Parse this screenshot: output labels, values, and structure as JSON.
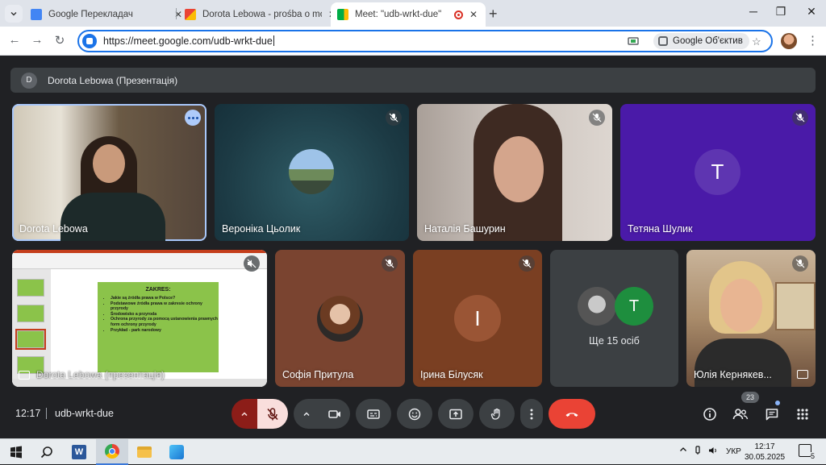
{
  "browser": {
    "tabs": [
      {
        "title": "Google Перекладач",
        "favicon_color": "#4285f4"
      },
      {
        "title": "Dorota Lebowa - prośba o możliwość",
        "favicon_color": "#ea4335"
      },
      {
        "title": "Meet: \"udb-wrkt-due\"",
        "favicon_color": "#00ac47",
        "active": true,
        "recording": true
      }
    ],
    "url": "https://meet.google.com/udb-wrkt-due",
    "lens_label": "Google Об'єктив"
  },
  "meet": {
    "presentation_bar": {
      "avatar": "D",
      "text": "Dorota Lebowa (Презентація)"
    },
    "tiles": [
      {
        "name": "Dorota Lebowa",
        "speaking": true
      },
      {
        "name": "Вероніка Цьолик",
        "muted": true
      },
      {
        "name": "Наталія Башурин",
        "muted": true
      },
      {
        "name": "Тетяна Шулик",
        "avatar_letter": "T",
        "avatar_color": "#5e35b1",
        "bg_color": "#4a1aa8",
        "muted": true
      },
      {
        "name": "Dorota Lebowa (презентація)",
        "type": "presentation"
      },
      {
        "name": "Софія Притула",
        "muted": true
      },
      {
        "name": "Ірина Білусяк",
        "avatar_letter": "I",
        "bg_color": "#7a3f22",
        "muted": true
      },
      {
        "name": "Юлія Кернякев...",
        "muted": true
      }
    ],
    "others": {
      "label": "Ще 15 осіб",
      "avatar_letter": "T",
      "avatar_color": "#1e8e3e"
    },
    "slide": {
      "heading": "ZAKRES:",
      "bullets": [
        "Jakie są źródła prawa w Polsce?",
        "Podstawowe źródła prawa w zakresie ochrony przyrody",
        "Środowisko a przyroda",
        "Ochrona przyrody za pomocą ustanowienia prawnych form ochrony przyrody",
        "Przykład - park narodowy"
      ]
    }
  },
  "controls": {
    "time": "12:17",
    "meeting_code": "udb-wrkt-due",
    "participants_count": "23",
    "mic_state": "off",
    "accent_red": "#ea4335",
    "mic_off_bg": "#f9dedc"
  },
  "taskbar": {
    "language": "УКР",
    "time": "12:17",
    "date": "30.05.2025",
    "notifications": "5"
  }
}
